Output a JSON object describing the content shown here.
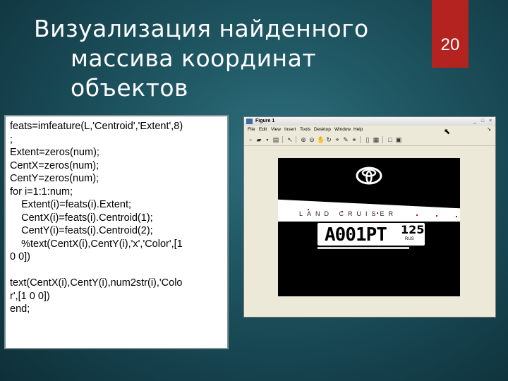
{
  "slide": {
    "title_lines": [
      "Визуализация найденного",
      "массива координат",
      "объектов"
    ],
    "page_number": "20"
  },
  "code": {
    "lines": [
      "feats=imfeature(L,'Centroid','Extent',8)",
      ";",
      "Extent=zeros(num);",
      "CentX=zeros(num);",
      "CentY=zeros(num);",
      "for i=1:1:num;",
      "    Extent(i)=feats(i).Extent;",
      "    CentX(i)=feats(i).Centroid(1);",
      "    CentY(i)=feats(i).Centroid(2);",
      "    %text(CentX(i),CentY(i),'x','Color',[1",
      "0 0])",
      "",
      "text(CentX(i),CentY(i),num2str(i),'Colo",
      "r',[1 0 0])",
      "end;"
    ]
  },
  "figure_window": {
    "title": "Figure 1",
    "menu": [
      "File",
      "Edit",
      "View",
      "Insert",
      "Tools",
      "Desktop",
      "Window",
      "Help"
    ],
    "window_buttons": [
      "_",
      "□",
      "×"
    ],
    "plate": {
      "number": "A001PT",
      "region": "125",
      "country": "RUS"
    },
    "brand_text": "LAND CRUISER"
  },
  "colors": {
    "title_bar_accent": "#b4231f",
    "annotation_color": "#c00000"
  }
}
